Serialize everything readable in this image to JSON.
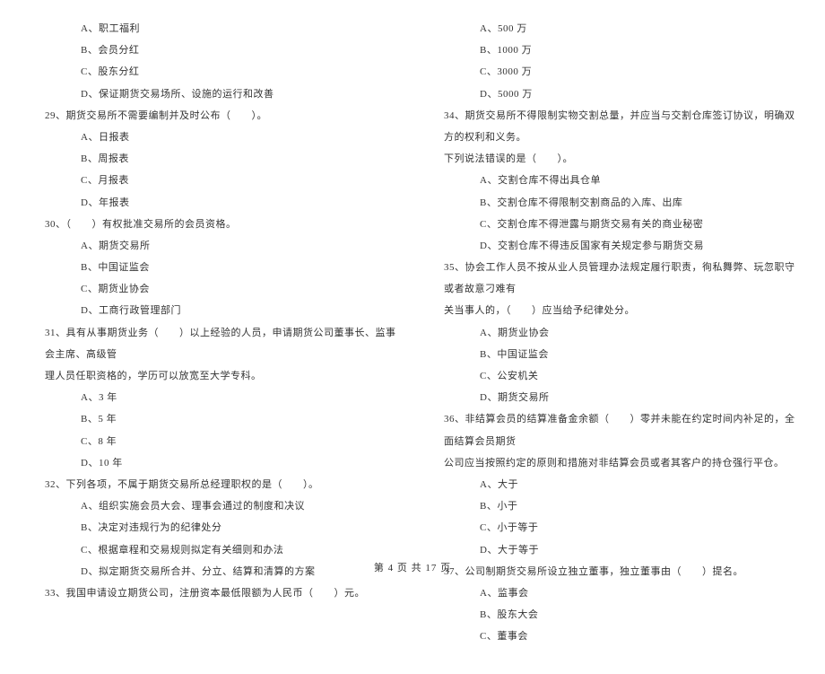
{
  "left": {
    "q28_opts": {
      "a": "A、职工福利",
      "b": "B、会员分红",
      "c": "C、股东分红",
      "d": "D、保证期货交易场所、设施的运行和改善"
    },
    "q29": {
      "stem": "29、期货交易所不需要编制并及时公布（　　）。",
      "a": "A、日报表",
      "b": "B、周报表",
      "c": "C、月报表",
      "d": "D、年报表"
    },
    "q30": {
      "stem": "30、（　　）有权批准交易所的会员资格。",
      "a": "A、期货交易所",
      "b": "B、中国证监会",
      "c": "C、期货业协会",
      "d": "D、工商行政管理部门"
    },
    "q31": {
      "stem1": "31、具有从事期货业务（　　）以上经验的人员，申请期货公司董事长、监事会主席、高级管",
      "stem2": "理人员任职资格的，学历可以放宽至大学专科。",
      "a": "A、3 年",
      "b": "B、5 年",
      "c": "C、8 年",
      "d": "D、10 年"
    },
    "q32": {
      "stem": "32、下列各项，不属于期货交易所总经理职权的是（　　）。",
      "a": "A、组织实施会员大会、理事会通过的制度和决议",
      "b": "B、决定对违规行为的纪律处分",
      "c": "C、根据章程和交易规则拟定有关细则和办法",
      "d": "D、拟定期货交易所合并、分立、结算和清算的方案"
    },
    "q33": {
      "stem": "33、我国申请设立期货公司，注册资本最低限额为人民币（　　）元。"
    }
  },
  "right": {
    "q33_opts": {
      "a": "A、500 万",
      "b": "B、1000 万",
      "c": "C、3000 万",
      "d": "D、5000 万"
    },
    "q34": {
      "stem1": "34、期货交易所不得限制实物交割总量，并应当与交割仓库签订协议，明确双方的权利和义务。",
      "stem2": "下列说法错误的是（　　）。",
      "a": "A、交割仓库不得出具仓单",
      "b": "B、交割仓库不得限制交割商品的入库、出库",
      "c": "C、交割仓库不得泄露与期货交易有关的商业秘密",
      "d": "D、交割仓库不得违反国家有关规定参与期货交易"
    },
    "q35": {
      "stem1": "35、协会工作人员不按从业人员管理办法规定履行职责，徇私舞弊、玩忽职守或者故意刁难有",
      "stem2": "关当事人的，（　　）应当给予纪律处分。",
      "a": "A、期货业协会",
      "b": "B、中国证监会",
      "c": "C、公安机关",
      "d": "D、期货交易所"
    },
    "q36": {
      "stem1": "36、非结算会员的结算准备金余额（　　）零并未能在约定时间内补足的，全面结算会员期货",
      "stem2": "公司应当按照约定的原则和措施对非结算会员或者其客户的持仓强行平仓。",
      "a": "A、大于",
      "b": "B、小于",
      "c": "C、小于等于",
      "d": "D、大于等于"
    },
    "q37": {
      "stem": "37、公司制期货交易所设立独立董事，独立董事由（　　）提名。",
      "a": "A、监事会",
      "b": "B、股东大会",
      "c": "C、董事会"
    }
  },
  "footer": "第 4 页 共 17 页"
}
